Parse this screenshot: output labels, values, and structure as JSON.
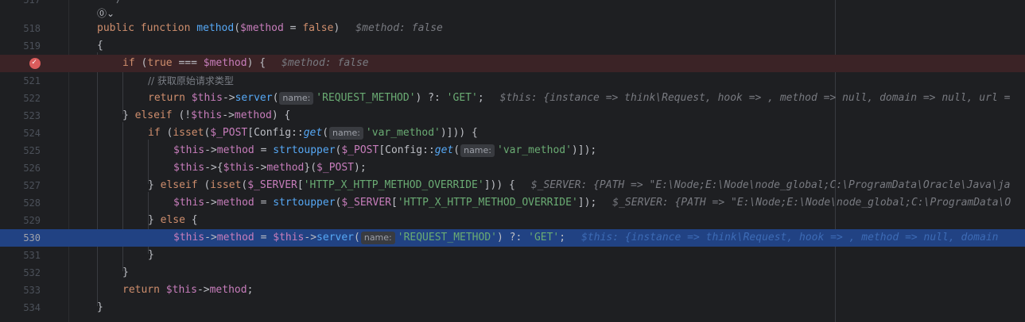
{
  "editor": {
    "lens_label": "⓪⌄",
    "top_partial": "*/",
    "lines": [
      {
        "num": "517"
      },
      {
        "num": "518"
      },
      {
        "num": "519"
      },
      {
        "num": "520"
      },
      {
        "num": "521"
      },
      {
        "num": "522"
      },
      {
        "num": "523"
      },
      {
        "num": "524"
      },
      {
        "num": "525"
      },
      {
        "num": "526"
      },
      {
        "num": "527"
      },
      {
        "num": "528"
      },
      {
        "num": "529"
      },
      {
        "num": "530"
      },
      {
        "num": "531"
      },
      {
        "num": "532"
      },
      {
        "num": "533"
      },
      {
        "num": "534"
      }
    ],
    "hint_name": "name:",
    "debug": {
      "method_false": "$method: false",
      "this_value": "$this: {instance => think\\Request, hook => , method => null, domain => null, url =",
      "this_value_short": "$this: {instance => think\\Request, hook => , method => null, domain",
      "server_value": "$_SERVER: {PATH => \"E:\\Node;E:\\Node\\node_global;C:\\ProgramData\\Oracle\\Java\\ja",
      "server_value_short": "$_SERVER: {PATH => \"E:\\Node;E:\\Node\\node_global;C:\\ProgramData\\O"
    },
    "tokens": {
      "public": "public",
      "function": "function",
      "method_name": "method",
      "param": "$method",
      "eq_false": " = ",
      "false": "false",
      "open_brace": "{",
      "close_brace": "}",
      "if": "if",
      "true": "true",
      "triple_eq": " === ",
      "comment": "// 获取原始请求类型",
      "return": "return",
      "this": "$this",
      "arrow": "->",
      "server": "server",
      "request_method": "'REQUEST_METHOD'",
      "elvis": " ?: ",
      "get": "'GET'",
      "elseif": "elseif",
      "else": "else",
      "isset": "isset",
      "post": "$_POST",
      "config": "Config::",
      "get_fn": "get",
      "var_method": "'var_method'",
      "strtoupper": "strtoupper",
      "server_var": "$_SERVER",
      "override": "'HTTP_X_HTTP_METHOD_OVERRIDE'",
      "method_prop": "method"
    }
  }
}
